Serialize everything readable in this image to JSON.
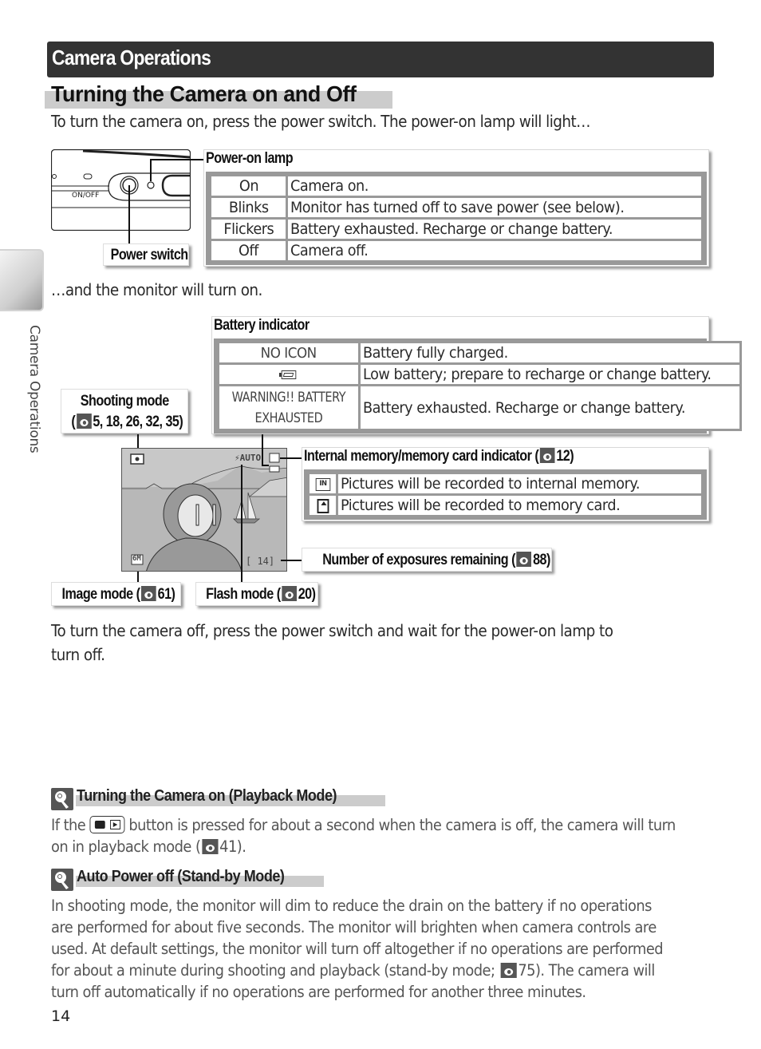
{
  "section_banner": "Camera Operations",
  "page_title": "Turning the Camera on and Off",
  "intro_text": "To turn the camera on, press the power switch.  The power-on lamp will light…",
  "camera_body": {
    "switch_label": "ON/OFF"
  },
  "power_on_lamp": {
    "title": "Power-on lamp",
    "rows": [
      {
        "state": "On",
        "meaning": "Camera on."
      },
      {
        "state": "Blinks",
        "meaning": "Monitor has turned off to save power (see below)."
      },
      {
        "state": "Flickers",
        "meaning": "Battery exhausted.  Recharge or change battery."
      },
      {
        "state": "Off",
        "meaning": "Camera off."
      }
    ]
  },
  "power_switch_label": "Power switch",
  "monitor_text": "…and the monitor will turn on.",
  "side_tab_label": "Camera Operations",
  "battery_indicator": {
    "title": "Battery indicator",
    "rows": [
      {
        "indicator": "NO ICON",
        "meaning": "Battery fully charged."
      },
      {
        "indicator": "low-battery-icon",
        "meaning": "Low battery; prepare to recharge or change battery."
      },
      {
        "indicator_line1": "WARNING!! BATTERY",
        "indicator_line2": "EXHAUSTED",
        "meaning": "Battery exhausted.  Recharge or change battery."
      }
    ]
  },
  "shooting_mode": {
    "label": "Shooting mode",
    "refs_open": "(",
    "refs": "5, 18, 26, 32, 35)"
  },
  "memory_indicator": {
    "title_prefix": "Internal memory/memory card indicator (",
    "title_ref": "12)",
    "rows": [
      {
        "icon": "internal-memory-icon",
        "meaning": "Pictures will be recorded to internal memory."
      },
      {
        "icon": "memory-card-icon",
        "meaning": "Pictures will be recorded to memory card."
      }
    ]
  },
  "lcd": {
    "flash": "⚡AUTO",
    "image_mode": "6M",
    "exposures": "[   14]"
  },
  "exposures_remaining": {
    "label_prefix": "Number of exposures remaining (",
    "ref": "88)"
  },
  "image_mode": {
    "label_prefix": "Image mode (",
    "ref": "61)"
  },
  "flash_mode": {
    "label_prefix": "Flash mode (",
    "ref": "20)"
  },
  "turn_off_text_line1": "To turn the camera off, press the power switch and wait for the power-on lamp to",
  "turn_off_text_line2": "turn off.",
  "notes": [
    {
      "title": "Turning the Camera on (Playback Mode)",
      "line1_before": "If the",
      "line1_after": "button is pressed for about a second when the camera is off, the camera will turn",
      "line2_before": "on in playback mode (",
      "line2_after": "41)."
    },
    {
      "title": "Auto Power off (Stand-by Mode)",
      "line1": "In shooting mode,  the monitor will dim to reduce the drain on the battery if no operations",
      "line2": "are performed for about five seconds.  The monitor will brighten when camera controls are",
      "line3": "used.  At default settings, the monitor will turn off altogether if no operations are performed",
      "line4_before": "for about a minute during shooting and playback (stand-by mode;",
      "line4_after": "75).  The camera will",
      "line5": "turn off automatically if no operations are performed for another three minutes."
    }
  ],
  "page_number": "14"
}
